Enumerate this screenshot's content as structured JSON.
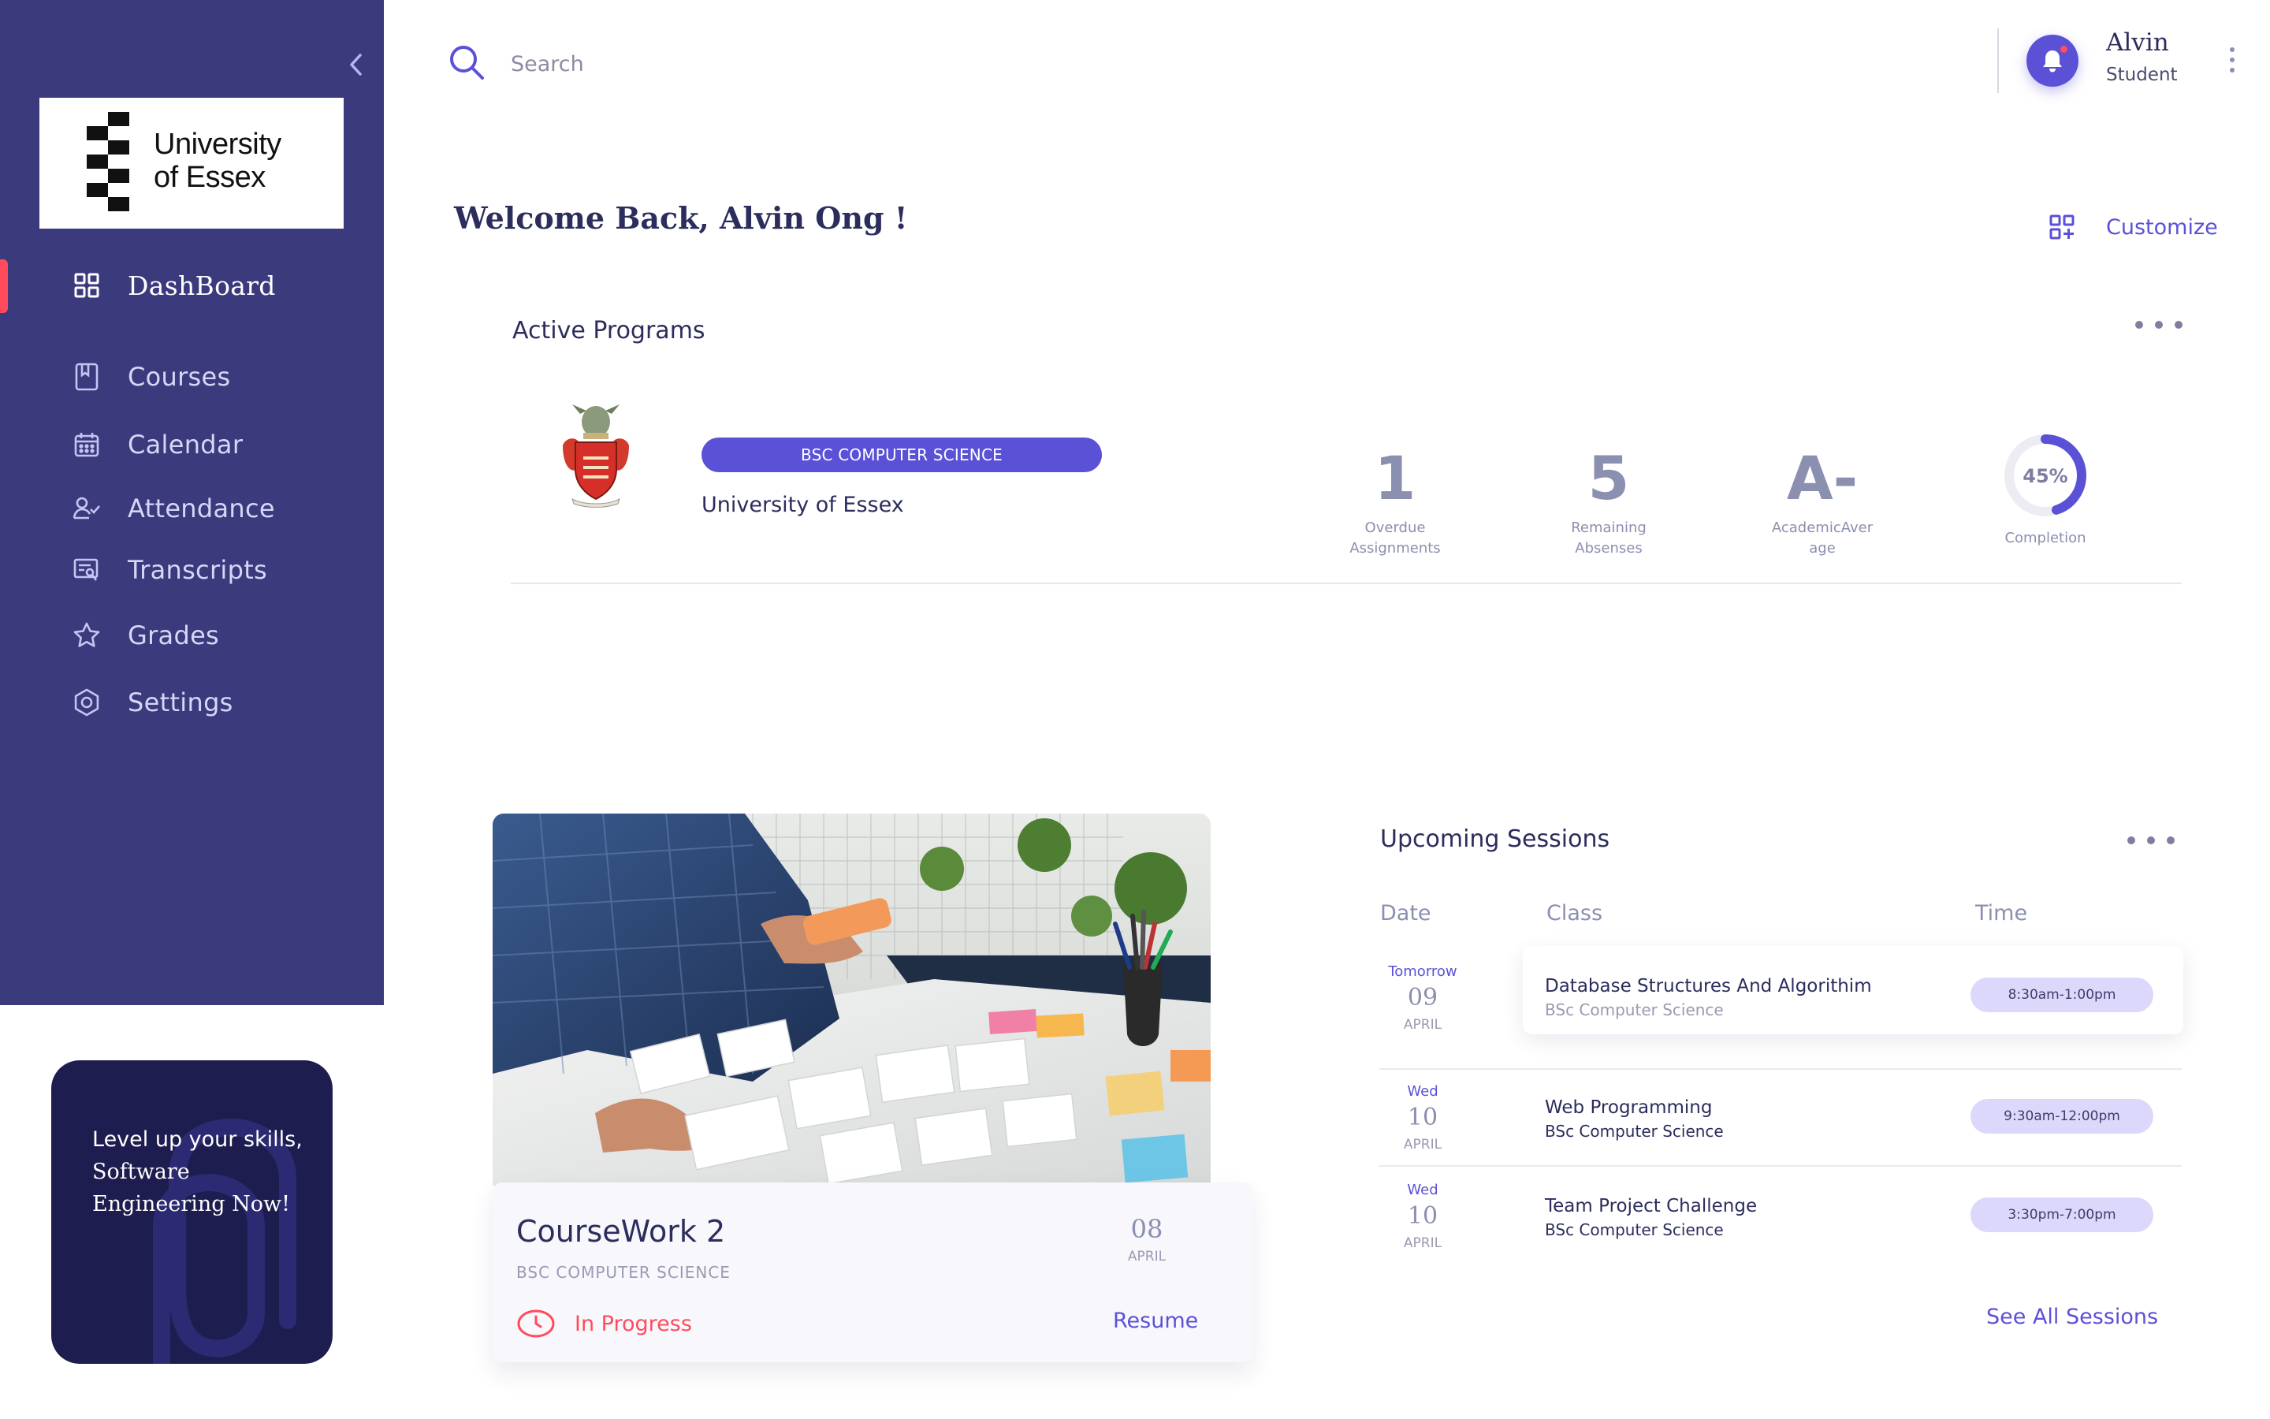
{
  "sidebar": {
    "logo": {
      "line1": "University",
      "line2": "of Essex"
    },
    "items": [
      {
        "label": "DashBoard",
        "icon": "grid-icon",
        "active": true
      },
      {
        "label": "Courses",
        "icon": "book-icon"
      },
      {
        "label": "Calendar",
        "icon": "calendar-icon"
      },
      {
        "label": "Attendance",
        "icon": "user-check-icon"
      },
      {
        "label": "Transcripts",
        "icon": "transcript-icon"
      },
      {
        "label": "Grades",
        "icon": "star-icon"
      },
      {
        "label": "Settings",
        "icon": "gear-icon"
      }
    ],
    "promo": {
      "line1": "Level up your skills,",
      "line2": "Software",
      "line3": "Engineering Now!"
    }
  },
  "header": {
    "search_placeholder": "Search",
    "user_name": "Alvin",
    "user_role": "Student"
  },
  "main": {
    "welcome": "Welcome Back, Alvin Ong !",
    "customize_label": "Customize",
    "active_programs": {
      "title": "Active Programs",
      "program_badge": "BSC COMPUTER SCIENCE",
      "university": "University of Essex",
      "stats": [
        {
          "value": "1",
          "label_line1": "Overdue",
          "label_line2": "Assignments"
        },
        {
          "value": "5",
          "label_line1": "Remaining",
          "label_line2": "Absenses"
        },
        {
          "value": "A-",
          "label_line1": "AcademicAver",
          "label_line2": "age"
        }
      ],
      "completion": {
        "value": "45%",
        "fraction": 0.45,
        "label": "Completion"
      }
    },
    "coursework": {
      "title": "CourseWork 2",
      "subtitle": "BSC COMPUTER SCIENCE",
      "day": "08",
      "month": "APRIL",
      "status": "In Progress",
      "action": "Resume"
    },
    "sessions": {
      "title": "Upcoming Sessions",
      "columns": {
        "date": "Date",
        "class": "Class",
        "time": "Time"
      },
      "rows": [
        {
          "day": "Tomorrow",
          "date": "09",
          "month": "APRIL",
          "class": "Database Structures And Algorithim",
          "program": "BSc Computer Science",
          "time": "8:30am-1:00pm"
        },
        {
          "day": "Wed",
          "date": "10",
          "month": "APRIL",
          "class": "Web Programming",
          "program": "BSc Computer Science",
          "time": "9:30am-12:00pm"
        },
        {
          "day": "Wed",
          "date": "10",
          "month": "APRIL",
          "class": "Team Project Challenge",
          "program": "BSc Computer Science",
          "time": "3:30pm-7:00pm"
        }
      ],
      "see_all": "See All Sessions"
    }
  },
  "colors": {
    "sidebar": "#3b3a7d",
    "accent": "#5b51d6",
    "alert": "#ff4b5c",
    "text": "#2b2d5c"
  }
}
